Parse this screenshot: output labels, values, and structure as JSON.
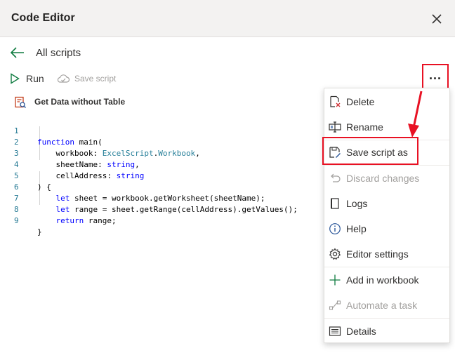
{
  "window": {
    "title": "Code Editor"
  },
  "nav": {
    "back_label": "All scripts"
  },
  "toolbar": {
    "run_label": "Run",
    "save_label": "Save script",
    "more_label": "..."
  },
  "script": {
    "name": "Get Data without Table"
  },
  "code": {
    "lines": [
      {
        "num": "1",
        "text": "function main("
      },
      {
        "num": "2",
        "text": "    workbook: ExcelScript.Workbook,"
      },
      {
        "num": "3",
        "text": "    sheetName: string,"
      },
      {
        "num": "4",
        "text": "    cellAddress: string"
      },
      {
        "num": "5",
        "text": ") {"
      },
      {
        "num": "6",
        "text": "    let sheet = workbook.getWorksheet(sheetName);"
      },
      {
        "num": "7",
        "text": "    let range = sheet.getRange(cellAddress).getValues();"
      },
      {
        "num": "8",
        "text": "    return range;"
      },
      {
        "num": "9",
        "text": "}"
      }
    ]
  },
  "menu": {
    "items": [
      {
        "label": "Delete",
        "icon": "delete-icon",
        "disabled": false
      },
      {
        "label": "Rename",
        "icon": "rename-icon",
        "disabled": false
      },
      {
        "label": "Save script as",
        "icon": "save-as-icon",
        "disabled": false
      },
      {
        "label": "Discard changes",
        "icon": "undo-icon",
        "disabled": true
      },
      {
        "label": "Logs",
        "icon": "logs-icon",
        "disabled": false
      },
      {
        "label": "Help",
        "icon": "info-icon",
        "disabled": false
      },
      {
        "label": "Editor settings",
        "icon": "gear-icon",
        "disabled": false
      },
      {
        "label": "Add in workbook",
        "icon": "plus-icon",
        "disabled": false
      },
      {
        "label": "Automate a task",
        "icon": "flow-icon",
        "disabled": true
      },
      {
        "label": "Details",
        "icon": "details-icon",
        "disabled": false
      }
    ]
  },
  "colors": {
    "highlight": "#e81123",
    "accent": "#107c41",
    "keyword": "#0000ff",
    "type": "#267f99"
  }
}
